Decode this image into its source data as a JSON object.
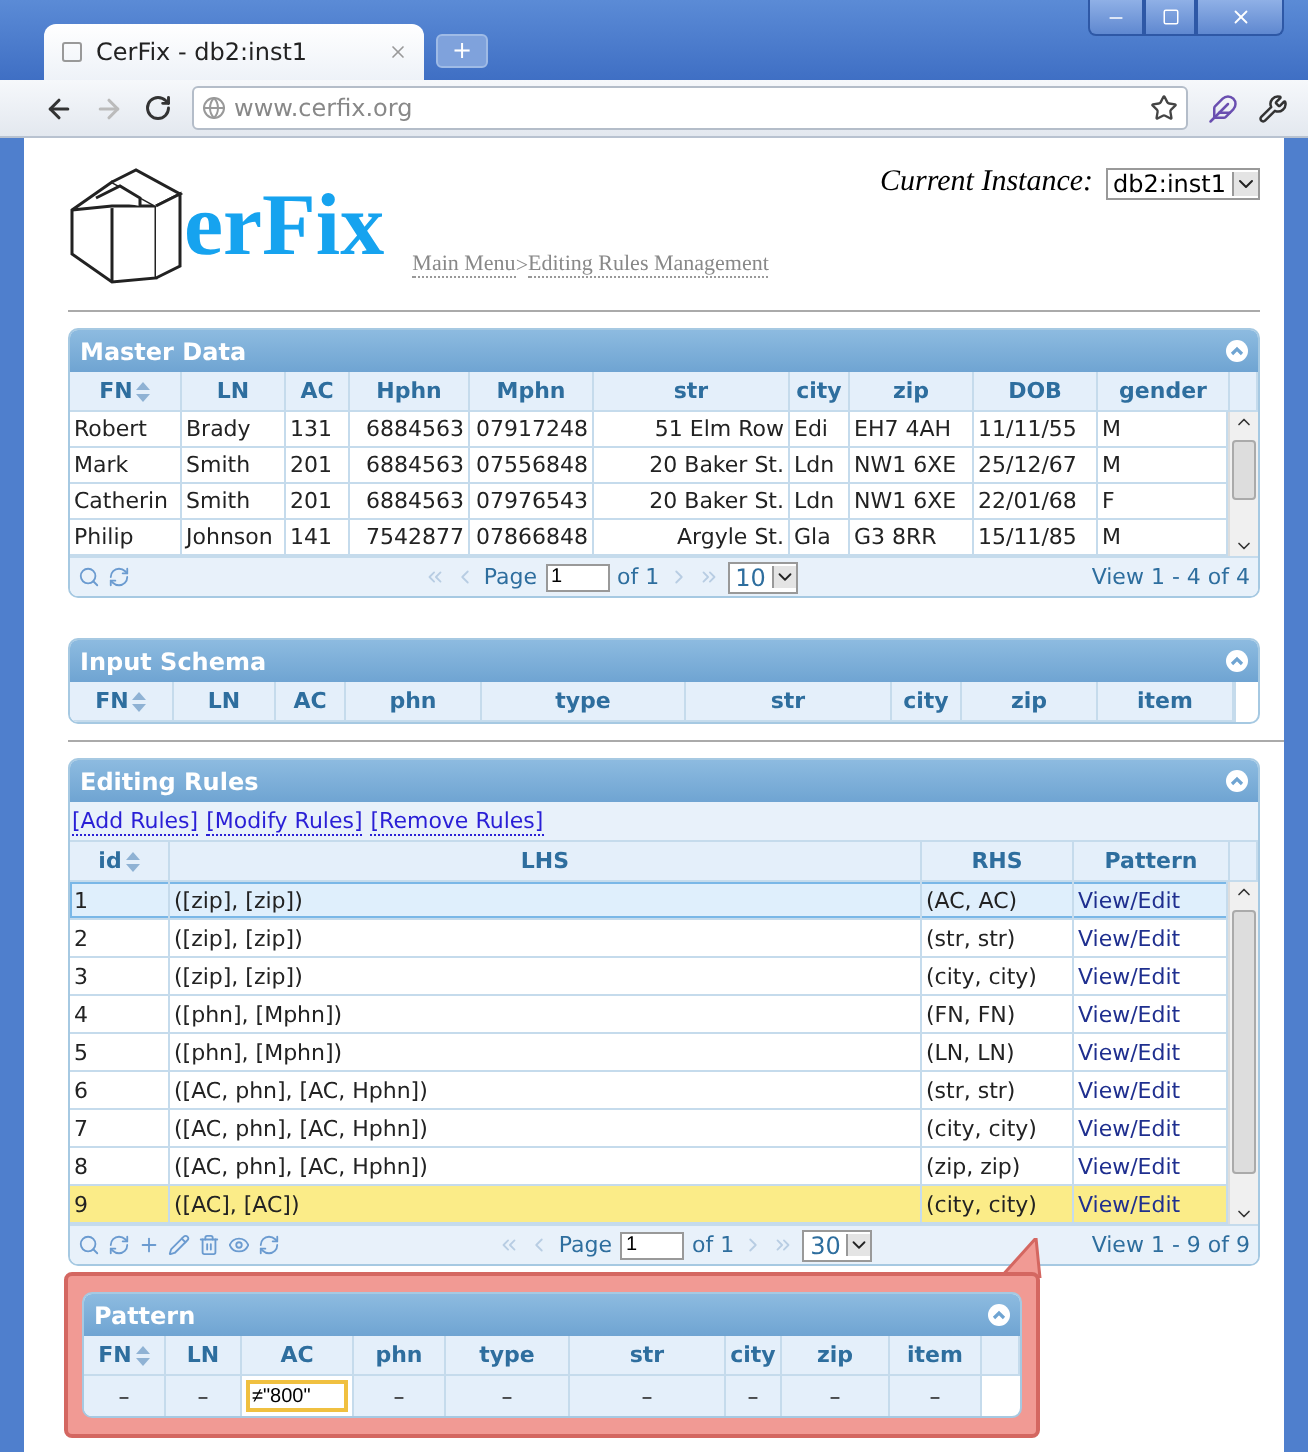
{
  "browser": {
    "tab_title": "CerFix - db2:inst1",
    "new_tab": "+",
    "url": "www.cerfix.org"
  },
  "header": {
    "logo_text": "erFix",
    "breadcrumb": [
      {
        "label": "Main Menu"
      },
      {
        "label": "Editing Rules Management"
      }
    ],
    "separator": ">",
    "instance_label": "Current Instance:",
    "instance_value": "db2:inst1"
  },
  "master_data": {
    "title": "Master Data",
    "columns": [
      {
        "label": "FN",
        "sorted": true
      },
      {
        "label": "LN",
        "sorted": false
      },
      {
        "label": "AC",
        "sorted": false
      },
      {
        "label": "Hphn",
        "sorted": false
      },
      {
        "label": "Mphn",
        "sorted": false
      },
      {
        "label": "str",
        "sorted": false
      },
      {
        "label": "city",
        "sorted": false
      },
      {
        "label": "zip",
        "sorted": false
      },
      {
        "label": "DOB",
        "sorted": false
      },
      {
        "label": "gender",
        "sorted": false
      }
    ],
    "rows": [
      [
        "Robert",
        "Brady",
        "131",
        "6884563",
        "07917248",
        "51 Elm Row",
        "Edi",
        "EH7 4AH",
        "11/11/55",
        "M"
      ],
      [
        "Mark",
        "Smith",
        "201",
        "6884563",
        "07556848",
        "20 Baker St.",
        "Ldn",
        "NW1 6XE",
        "25/12/67",
        "M"
      ],
      [
        "Catherin",
        "Smith",
        "201",
        "6884563",
        "07976543",
        "20 Baker St.",
        "Ldn",
        "NW1 6XE",
        "22/01/68",
        "F"
      ],
      [
        "Philip",
        "Johnson",
        "141",
        "7542877",
        "07866848",
        "Argyle St.",
        "Gla",
        "G3 8RR",
        "15/11/85",
        "M"
      ]
    ],
    "pager": {
      "kind": "basic",
      "page_label": "Page",
      "page": "1",
      "of": "of 1",
      "page_size": "10",
      "view": "View 1 - 4 of 4"
    }
  },
  "input_schema": {
    "title": "Input Schema",
    "columns": [
      {
        "label": "FN",
        "sorted": true
      },
      {
        "label": "LN",
        "sorted": false
      },
      {
        "label": "AC",
        "sorted": false
      },
      {
        "label": "phn",
        "sorted": false
      },
      {
        "label": "type",
        "sorted": false
      },
      {
        "label": "str",
        "sorted": false
      },
      {
        "label": "city",
        "sorted": false
      },
      {
        "label": "zip",
        "sorted": false
      },
      {
        "label": "item",
        "sorted": false
      }
    ]
  },
  "editing_rules": {
    "title": "Editing Rules",
    "actions": [
      {
        "label": "[Add Rules]"
      },
      {
        "label": "[Modify Rules]"
      },
      {
        "label": "[Remove Rules]"
      }
    ],
    "columns": [
      {
        "label": "id",
        "sorted": true
      },
      {
        "label": "LHS",
        "sorted": false
      },
      {
        "label": "RHS",
        "sorted": false
      },
      {
        "label": "Pattern",
        "sorted": false
      }
    ],
    "rows": [
      {
        "id": "1",
        "lhs": "([zip], [zip])",
        "rhs": "(AC, AC)",
        "pattern": "View/Edit",
        "selected": true,
        "editing": false
      },
      {
        "id": "2",
        "lhs": "([zip], [zip])",
        "rhs": "(str, str)",
        "pattern": "View/Edit",
        "selected": false,
        "editing": false
      },
      {
        "id": "3",
        "lhs": "([zip], [zip])",
        "rhs": "(city, city)",
        "pattern": "View/Edit",
        "selected": false,
        "editing": false
      },
      {
        "id": "4",
        "lhs": "([phn], [Mphn])",
        "rhs": "(FN, FN)",
        "pattern": "View/Edit",
        "selected": false,
        "editing": false
      },
      {
        "id": "5",
        "lhs": "([phn], [Mphn])",
        "rhs": "(LN, LN)",
        "pattern": "View/Edit",
        "selected": false,
        "editing": false
      },
      {
        "id": "6",
        "lhs": "([AC, phn], [AC, Hphn])",
        "rhs": "(str, str)",
        "pattern": "View/Edit",
        "selected": false,
        "editing": false
      },
      {
        "id": "7",
        "lhs": "([AC, phn], [AC, Hphn])",
        "rhs": "(city, city)",
        "pattern": "View/Edit",
        "selected": false,
        "editing": false
      },
      {
        "id": "8",
        "lhs": "([AC, phn], [AC, Hphn])",
        "rhs": "(zip, zip)",
        "pattern": "View/Edit",
        "selected": false,
        "editing": false
      },
      {
        "id": "9",
        "lhs": "([AC], [AC])",
        "rhs": "(city, city)",
        "pattern": "View/Edit",
        "selected": false,
        "editing": true
      }
    ],
    "pager": {
      "kind": "editable",
      "page_label": "Page",
      "page": "1",
      "of": "of 1",
      "page_size": "30",
      "view": "View 1 - 9 of 9"
    }
  },
  "pattern": {
    "title": "Pattern",
    "columns": [
      {
        "label": "FN",
        "sorted": true
      },
      {
        "label": "LN",
        "sorted": false
      },
      {
        "label": "AC",
        "sorted": false
      },
      {
        "label": "phn",
        "sorted": false
      },
      {
        "label": "type",
        "sorted": false
      },
      {
        "label": "str",
        "sorted": false
      },
      {
        "label": "city",
        "sorted": false
      },
      {
        "label": "zip",
        "sorted": false
      },
      {
        "label": "item",
        "sorted": false
      }
    ],
    "cells": [
      {
        "kind": "text",
        "value": "–"
      },
      {
        "kind": "text",
        "value": "–"
      },
      {
        "kind": "input",
        "value": "≠\"800\""
      },
      {
        "kind": "text",
        "value": "–"
      },
      {
        "kind": "text",
        "value": "–"
      },
      {
        "kind": "text",
        "value": "–"
      },
      {
        "kind": "text",
        "value": "–"
      },
      {
        "kind": "text",
        "value": "–"
      },
      {
        "kind": "text",
        "value": "–"
      }
    ]
  }
}
